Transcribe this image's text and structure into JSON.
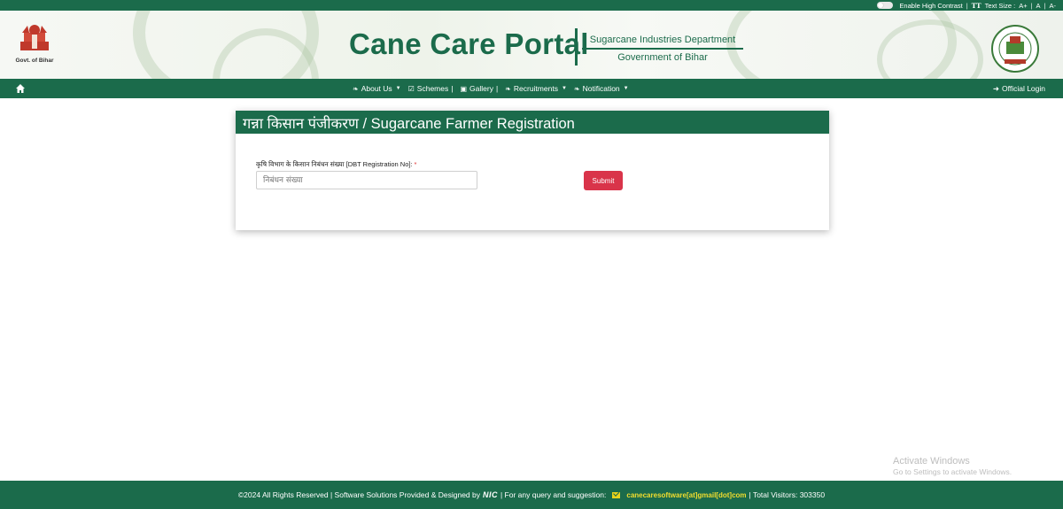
{
  "topbar": {
    "high_contrast_label": "Enable High Contrast",
    "text_size_label": "Text Size :",
    "text_size_icon": "TT",
    "size_larger": "A+",
    "size_normal": "A",
    "size_smaller": "A-"
  },
  "header": {
    "gov_caption": "Govt. of Bihar",
    "portal_title": "Cane Care Portal",
    "department": "Sugarcane Industries Department",
    "government": "Government of Bihar"
  },
  "nav": {
    "home_icon": "home-icon",
    "items": [
      {
        "label": "About Us",
        "icon": "leaf-icon",
        "caret": true,
        "sep": ""
      },
      {
        "label": "Schemes",
        "icon": "check-square-icon",
        "caret": false,
        "sep": "|"
      },
      {
        "label": "Gallery",
        "icon": "image-icon",
        "caret": false,
        "sep": "|"
      },
      {
        "label": "Recruitments",
        "icon": "leaf-icon",
        "caret": true,
        "sep": ""
      },
      {
        "label": "Notification",
        "icon": "leaf-icon",
        "caret": true,
        "sep": ""
      }
    ],
    "login_label": "Official Login"
  },
  "form": {
    "heading": "गन्ना किसान पंजीकरण / Sugarcane Farmer Registration",
    "field_label": "कृषि विभाग के किसान निबंधन संख्या [DBT Registration No]:",
    "required_mark": "*",
    "field_placeholder": "निबंधन संख्या",
    "field_value": "",
    "submit_label": "Submit"
  },
  "watermark": {
    "title": "Activate Windows",
    "subtitle": "Go to Settings to activate Windows."
  },
  "footer": {
    "copyright": "©2024 All Rights Reserved | Software Solutions Provided & Designed by",
    "nic": "NIC",
    "query": "| For any query and suggestion:",
    "email": "canecaresoftware[at]gmail[dot]com",
    "visitors": "| Total Visitors: 303350"
  },
  "colors": {
    "primary": "#1b6b4b",
    "submit": "#d9344a",
    "email": "#f2dd2e"
  }
}
